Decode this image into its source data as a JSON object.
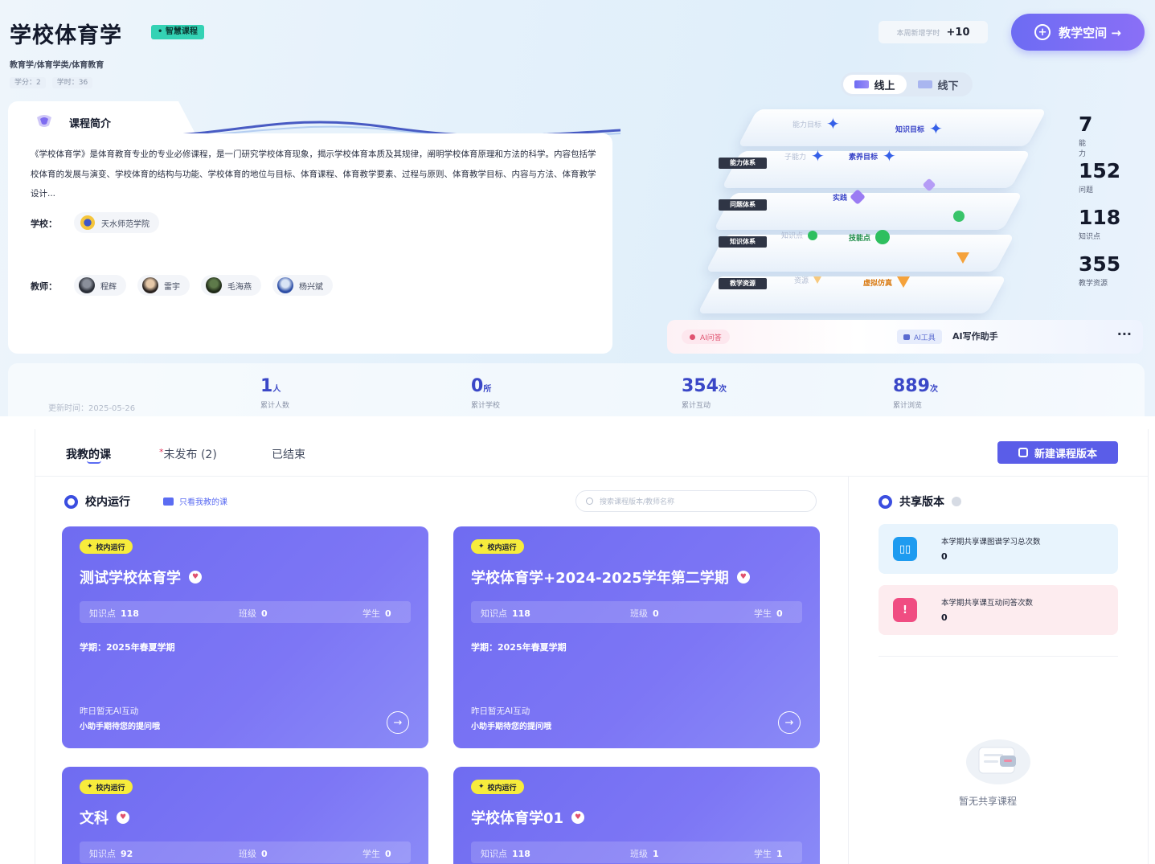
{
  "header": {
    "title": "学校体育学",
    "title_tag": "• 智慧课程",
    "breadcrumb": "教育学/体育学类/体育教育",
    "credits": "学分：2",
    "hours": "学时：36",
    "study_hours_label": "本周新增学时",
    "study_hours_value": "+10",
    "space_button": "教学空间 →",
    "mode_online": "线上",
    "mode_offline": "线下"
  },
  "intro": {
    "title": "课程简介",
    "text": "《学校体育学》是体育教育专业的专业必修课程，是一门研究学校体育现象，揭示学校体育本质及其规律，阐明学校体育原理和方法的科学。内容包括学校体育的发展与演变、学校体育的结构与功能、学校体育的地位与目标、体育课程、体育教学要素、过程与原则、体育教学目标、内容与方法、体育教学设计...",
    "school_label": "学校：",
    "school_name": "天水师范学院",
    "teacher_label": "教师：",
    "teachers": [
      "程辉",
      "雷宇",
      "毛海燕",
      "杨兴斌"
    ]
  },
  "layers": {
    "tags": [
      "能力体系",
      "问题体系",
      "知识体系",
      "教学资源"
    ],
    "nodes": {
      "ability_faint": "能力目标",
      "knowledge_goal": "知识目标",
      "sub_ability": "子能力",
      "literacy_goal": "素养目标",
      "practice": "实践",
      "knowledge_point_faint": "知识点",
      "skill_point": "技能点",
      "resource_faint": "资源",
      "virtual_sim": "虚拟仿真"
    }
  },
  "side_stats": [
    {
      "value": "7",
      "label": "能力"
    },
    {
      "value": "152",
      "label": "问题"
    },
    {
      "value": "118",
      "label": "知识点"
    },
    {
      "value": "355",
      "label": "教学资源"
    }
  ],
  "ai_bar": {
    "ai_qa": "AI问答",
    "ai_tool": "AI工具",
    "ai_writer": "AI写作助手",
    "more": "···"
  },
  "bottom_stats": {
    "update_time": "更新时间：2025-05-26",
    "items": [
      {
        "value": "1",
        "unit": "人",
        "label": "累计人数"
      },
      {
        "value": "0",
        "unit": "所",
        "label": "累计学校"
      },
      {
        "value": "354",
        "unit": "次",
        "label": "累计互动"
      },
      {
        "value": "889",
        "unit": "次",
        "label": "累计浏览"
      }
    ]
  },
  "tabs": {
    "my_courses": "我教的课",
    "unpublished": "未发布 (2)",
    "ended": "已结束",
    "new_version": "新建课程版本"
  },
  "campus": {
    "title": "校内运行",
    "only_mine": "只看我教的课",
    "search_placeholder": "搜索课程版本/教师名称"
  },
  "courses": [
    {
      "badge": "校内运行",
      "title": "测试学校体育学",
      "kp_label": "知识点",
      "kp": "118",
      "class_label": "班级",
      "classes": "0",
      "stu_label": "学生",
      "students": "0",
      "term": "学期：2025年春夏学期",
      "ai1": "昨日暂无AI互动",
      "ai2": "小助手期待您的提问哦"
    },
    {
      "badge": "校内运行",
      "title": "学校体育学+2024-2025学年第二学期",
      "kp_label": "知识点",
      "kp": "118",
      "class_label": "班级",
      "classes": "0",
      "stu_label": "学生",
      "students": "0",
      "term": "学期：2025年春夏学期",
      "ai1": "昨日暂无AI互动",
      "ai2": "小助手期待您的提问哦"
    },
    {
      "badge": "校内运行",
      "title": "文科",
      "kp_label": "知识点",
      "kp": "92",
      "class_label": "班级",
      "classes": "0",
      "stu_label": "学生",
      "students": "0"
    },
    {
      "badge": "校内运行",
      "title": "学校体育学01",
      "kp_label": "知识点",
      "kp": "118",
      "class_label": "班级",
      "classes": "1",
      "stu_label": "学生",
      "students": "1"
    }
  ],
  "shared": {
    "title": "共享版本",
    "cards": [
      {
        "label": "本学期共享课图谱学习总次数",
        "value": "0",
        "color": "#1e9bf0"
      },
      {
        "label": "本学期共享课互动问答次数",
        "value": "0",
        "color": "#f04d82"
      }
    ],
    "empty": "暂无共享课程"
  }
}
